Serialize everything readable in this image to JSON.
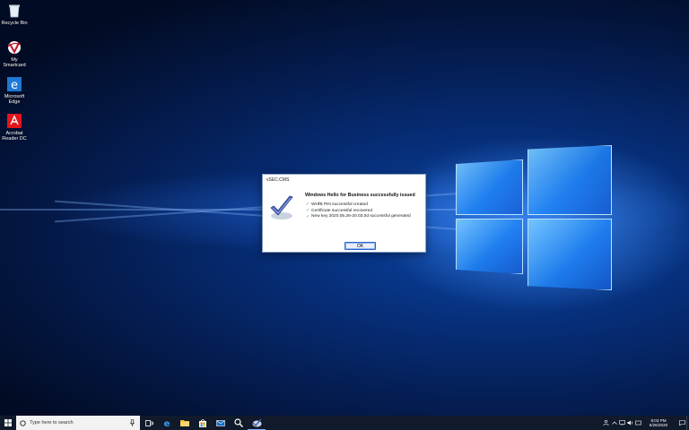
{
  "desktop": {
    "icons": [
      {
        "label": "Recycle Bin",
        "icon": "recycle-bin-icon"
      },
      {
        "label": "My Smartcard",
        "icon": "smartcard-icon"
      },
      {
        "label": "Microsoft Edge",
        "icon": "edge-icon"
      },
      {
        "label": "Acrobat Reader DC",
        "icon": "acrobat-icon"
      }
    ]
  },
  "dialog": {
    "title": "vSEC:CMS",
    "heading": "Windows Hello for Business successfully issued",
    "items": [
      "WHfB PIN successful created",
      "Certificate successful recovered",
      "New key 2020.05.26-20.03.0d successful generated"
    ],
    "ok_label": "OK",
    "accent": "#2a5fd6"
  },
  "taskbar": {
    "search_placeholder": "Type here to search",
    "icons": [
      "start-icon",
      "task-view-icon",
      "edge-icon",
      "file-explorer-icon",
      "store-icon",
      "mail-icon",
      "search-tool-icon",
      "vsec-cms-icon"
    ],
    "clock": {
      "time": "8:03 PM",
      "date": "5/26/2020"
    }
  }
}
